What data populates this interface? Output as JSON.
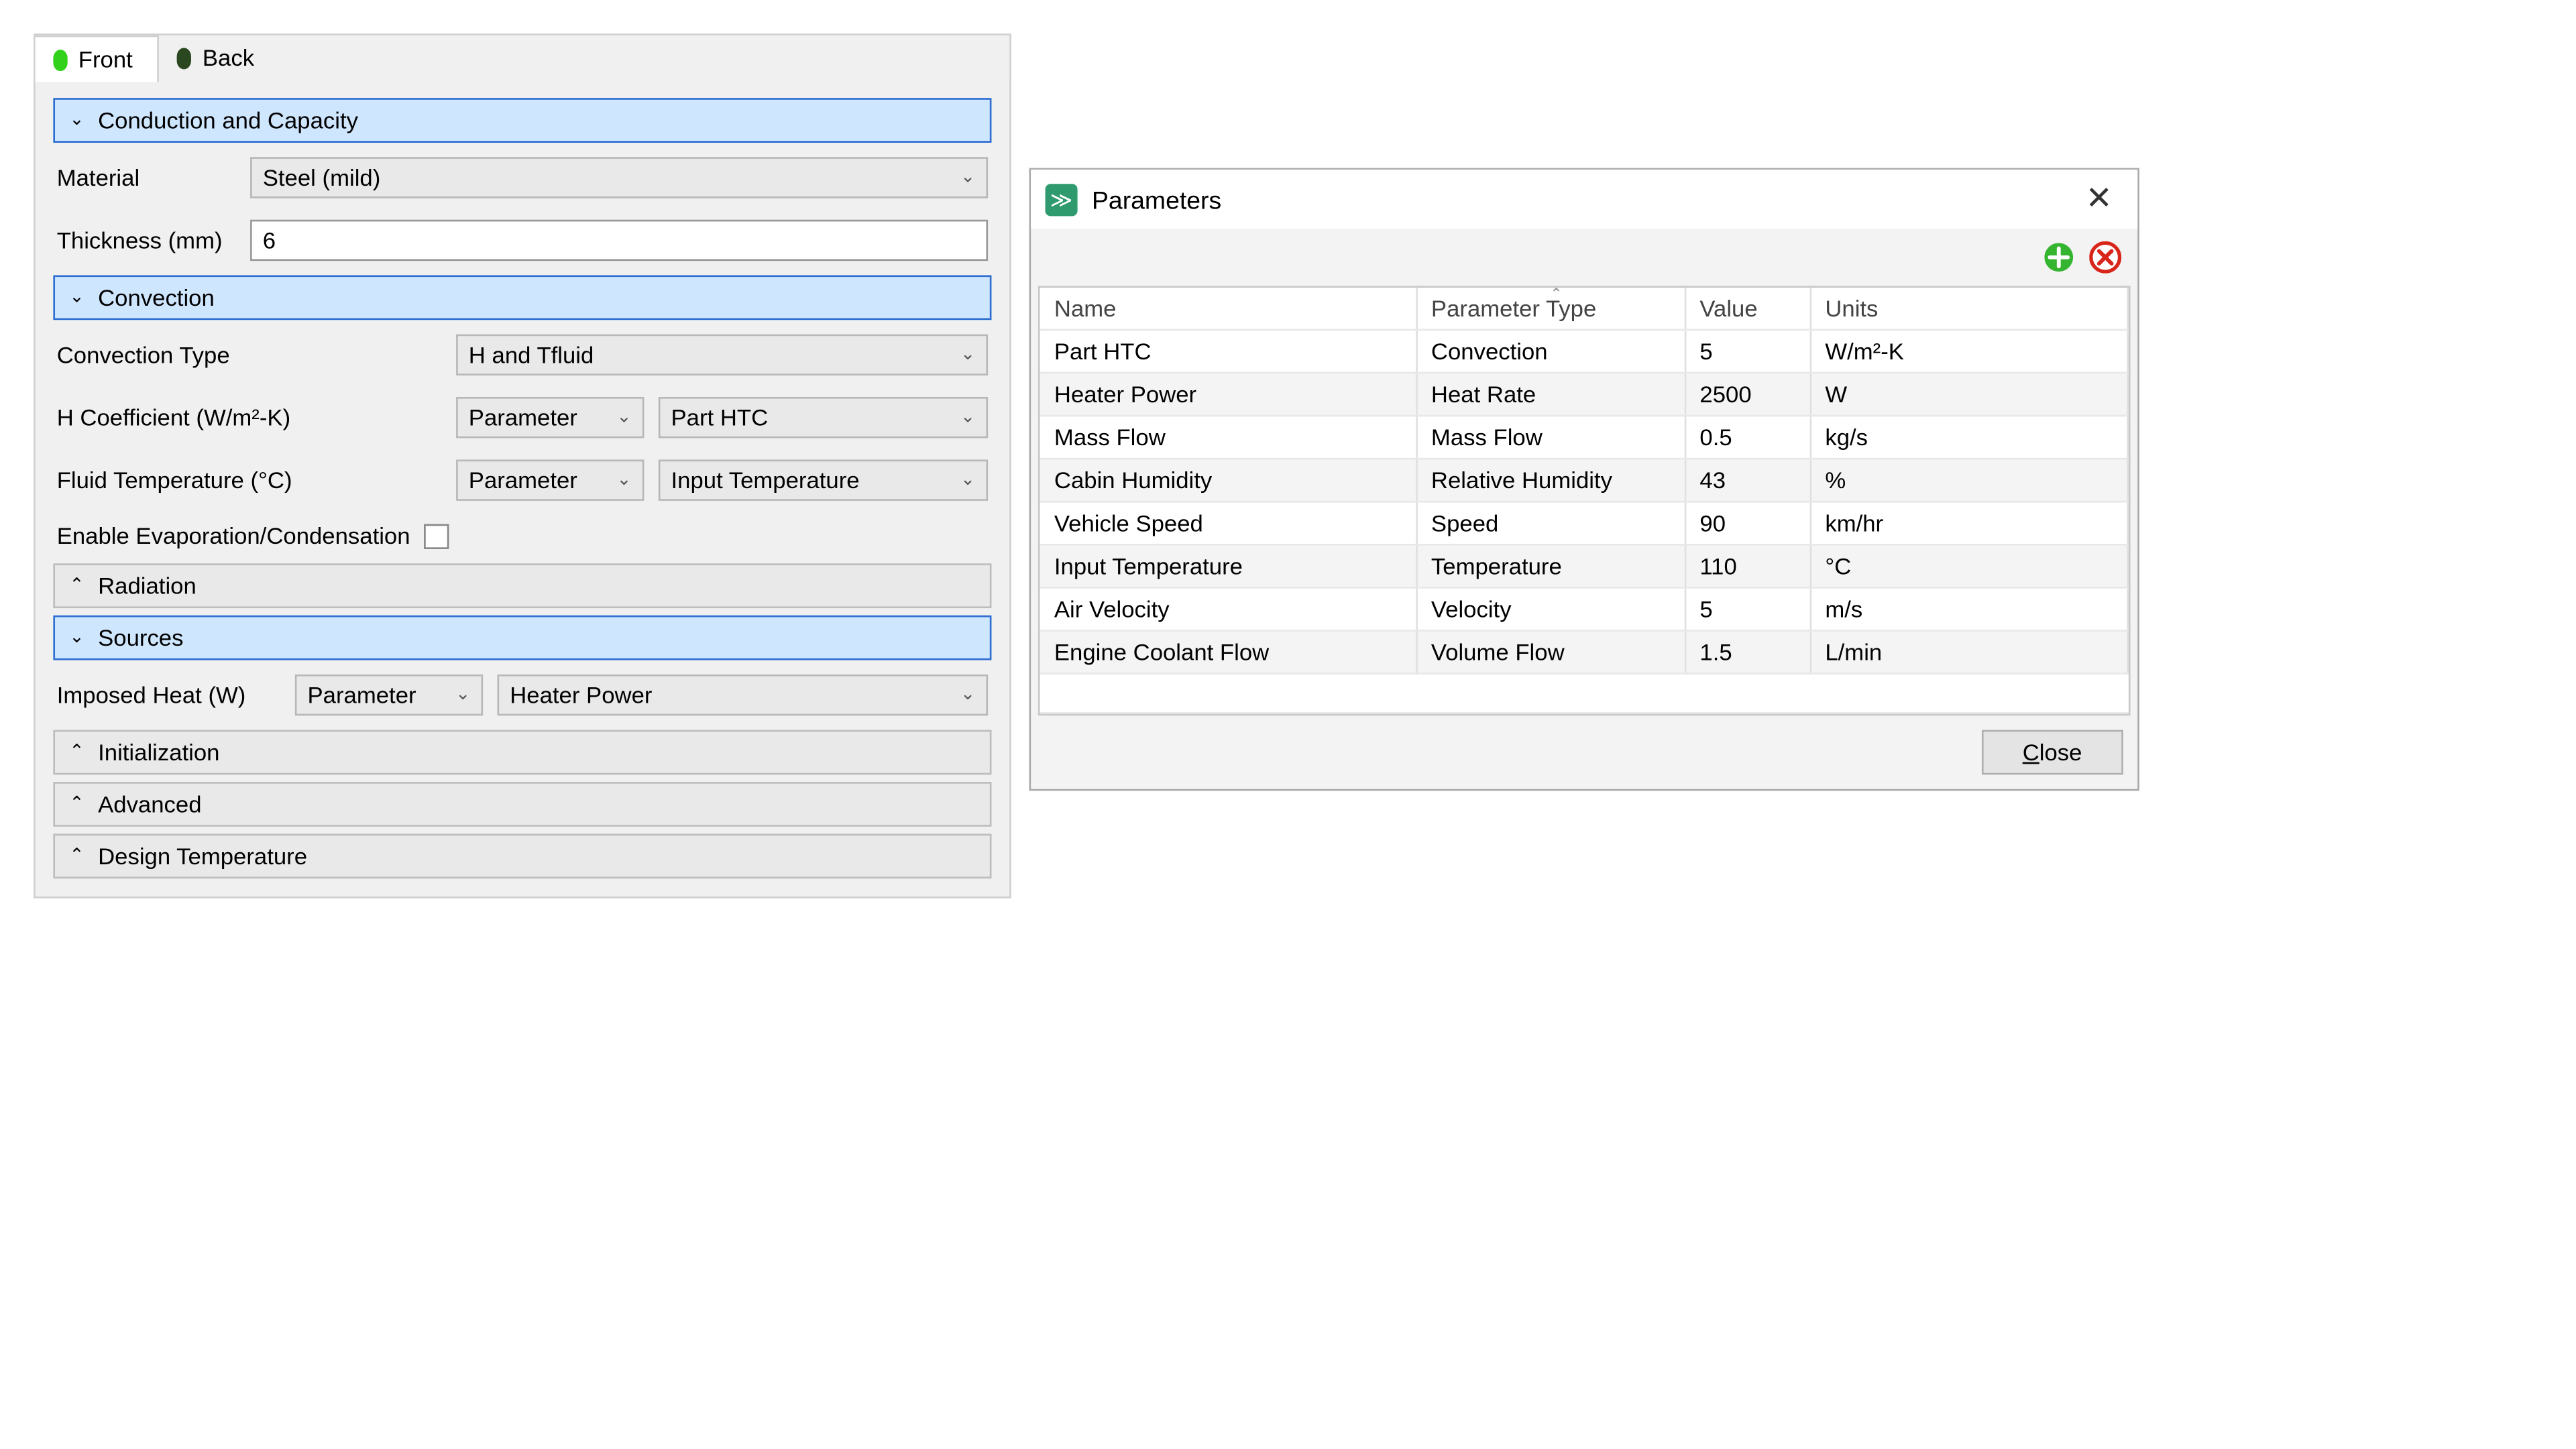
{
  "tabs": {
    "front": "Front",
    "back": "Back"
  },
  "sections": {
    "conduction": {
      "title": "Conduction and Capacity",
      "material_label": "Material",
      "material_value": "Steel (mild)",
      "thickness_label": "Thickness (mm)",
      "thickness_value": "6"
    },
    "convection": {
      "title": "Convection",
      "type_label": "Convection Type",
      "type_value": "H and Tfluid",
      "hcoef_label": "H Coefficient (W/m²-K)",
      "hcoef_kind": "Parameter",
      "hcoef_value": "Part HTC",
      "ftemp_label": "Fluid Temperature (°C)",
      "ftemp_kind": "Parameter",
      "ftemp_value": "Input Temperature",
      "evap_label": "Enable Evaporation/Condensation"
    },
    "radiation": {
      "title": "Radiation"
    },
    "sources": {
      "title": "Sources",
      "heat_label": "Imposed Heat (W)",
      "heat_kind": "Parameter",
      "heat_value": "Heater Power"
    },
    "initialization": {
      "title": "Initialization"
    },
    "advanced": {
      "title": "Advanced"
    },
    "designtemp": {
      "title": "Design Temperature"
    }
  },
  "dialog": {
    "title": "Parameters",
    "close_button": "Close",
    "columns": {
      "name": "Name",
      "type": "Parameter Type",
      "value": "Value",
      "units": "Units"
    },
    "rows": [
      {
        "name": "Part HTC",
        "type": "Convection",
        "value": "5",
        "units": "W/m²-K"
      },
      {
        "name": "Heater Power",
        "type": "Heat Rate",
        "value": "2500",
        "units": "W"
      },
      {
        "name": "Mass Flow",
        "type": "Mass Flow",
        "value": "0.5",
        "units": "kg/s"
      },
      {
        "name": "Cabin Humidity",
        "type": "Relative Humidity",
        "value": "43",
        "units": "%"
      },
      {
        "name": "Vehicle Speed",
        "type": "Speed",
        "value": "90",
        "units": "km/hr"
      },
      {
        "name": "Input Temperature",
        "type": "Temperature",
        "value": "110",
        "units": "°C"
      },
      {
        "name": "Air Velocity",
        "type": "Velocity",
        "value": "5",
        "units": "m/s"
      },
      {
        "name": "Engine Coolant Flow",
        "type": "Volume Flow",
        "value": "1.5",
        "units": "L/min"
      }
    ]
  }
}
